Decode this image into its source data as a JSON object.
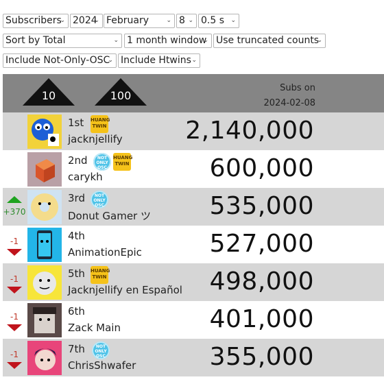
{
  "controls": {
    "metric": "Subscribers",
    "year": "2024",
    "month": "February",
    "day": "8",
    "speed": "0.5 s",
    "sort": "Sort by Total",
    "window": "1 month window",
    "counts": "Use truncated counts",
    "not_only_osc": "Include Not-Only-OSC",
    "htwins": "Include Htwins"
  },
  "header": {
    "left_button": "10",
    "right_button": "100",
    "subs_label": "Subs on",
    "subs_date": "2024-02-08"
  },
  "badges": {
    "huang_twin": [
      "HUANG",
      "TWIN"
    ],
    "not_only_osc": [
      "NOT",
      "ONLY",
      "OSC"
    ]
  },
  "rows": [
    {
      "rank": "1st",
      "name": "jacknjellify",
      "count": "2,140,000",
      "change": "",
      "direction": "none",
      "badges": [
        "huang_twin"
      ]
    },
    {
      "rank": "2nd",
      "name": "carykh",
      "count": "600,000",
      "change": "",
      "direction": "none",
      "badges": [
        "not_only_osc",
        "huang_twin"
      ]
    },
    {
      "rank": "3rd",
      "name": "Donut Gamer ツ",
      "count": "535,000",
      "change": "+370",
      "direction": "up",
      "badges": [
        "not_only_osc"
      ]
    },
    {
      "rank": "4th",
      "name": "AnimationEpic",
      "count": "527,000",
      "change": "-1",
      "direction": "down",
      "badges": []
    },
    {
      "rank": "5th",
      "name": "Jacknjellify en Español",
      "count": "498,000",
      "change": "-1",
      "direction": "down",
      "badges": [
        "huang_twin"
      ]
    },
    {
      "rank": "6th",
      "name": "Zack Main",
      "count": "401,000",
      "change": "-1",
      "direction": "down",
      "badges": []
    },
    {
      "rank": "7th",
      "name": "ChrisShwafer",
      "count": "355,000",
      "change": "-1",
      "direction": "down",
      "badges": [
        "not_only_osc"
      ]
    }
  ]
}
